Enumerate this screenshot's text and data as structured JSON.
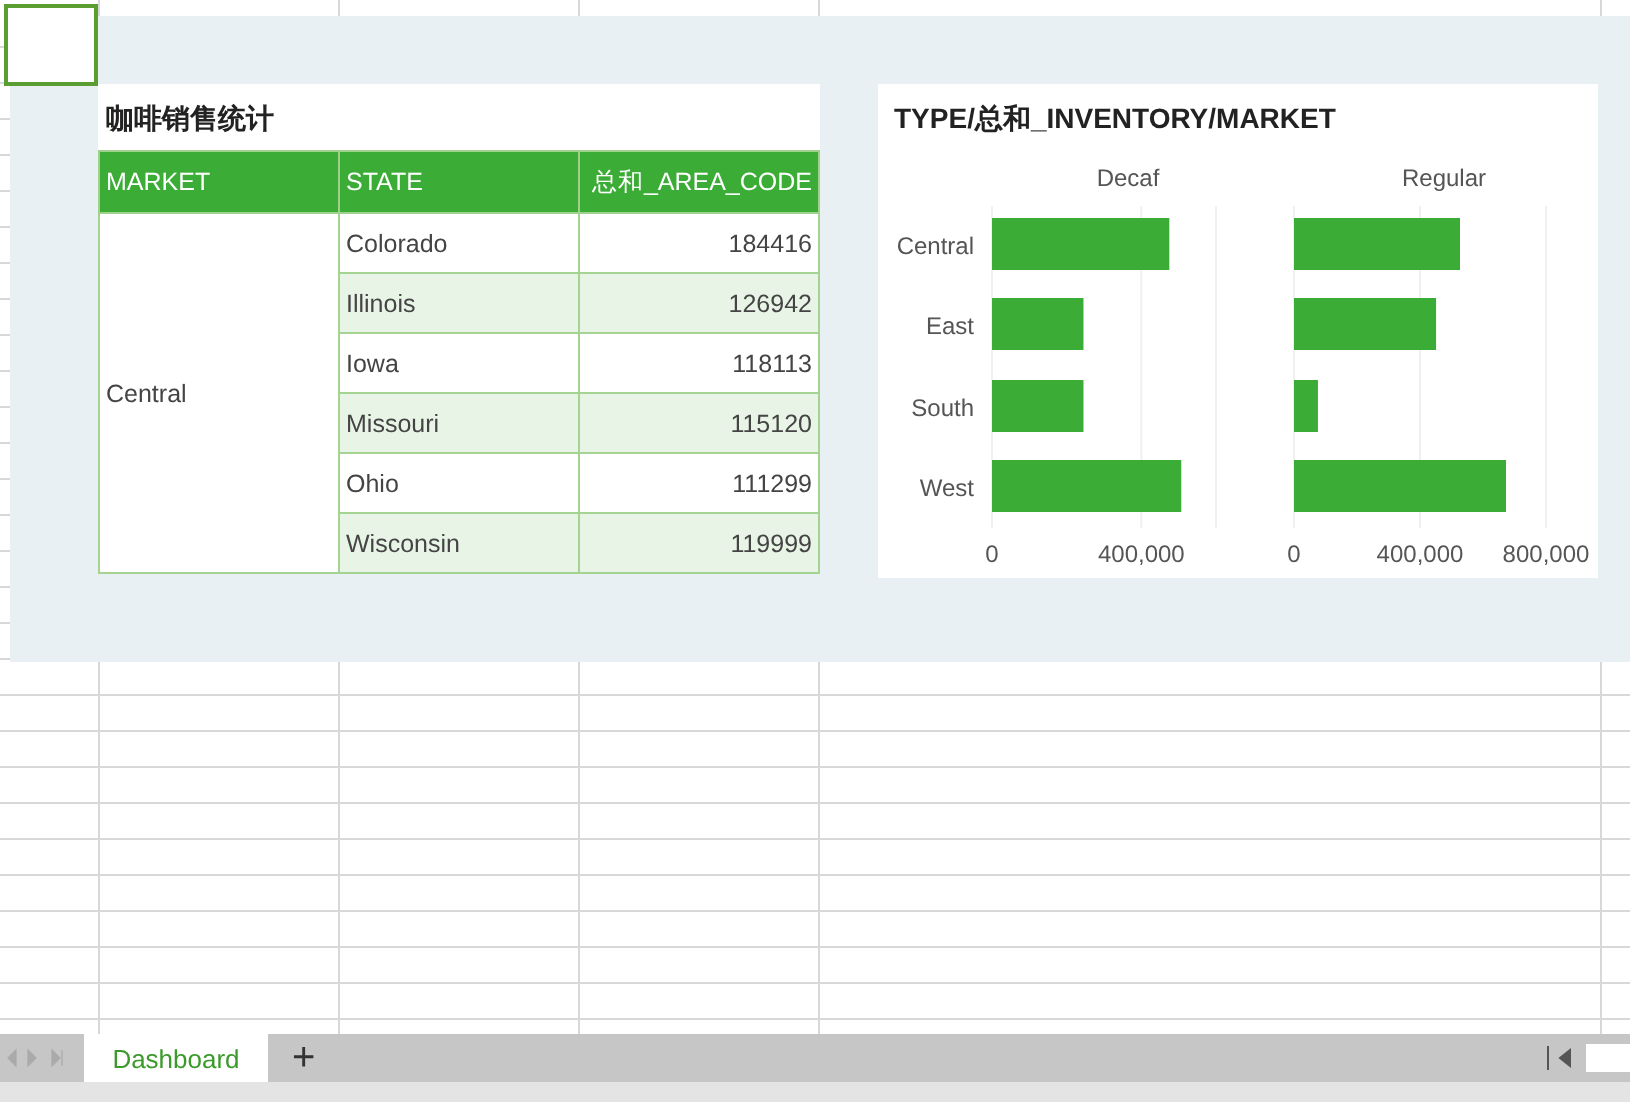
{
  "table": {
    "title": "咖啡销售统计",
    "columns": [
      "MARKET",
      "STATE",
      "总和_AREA_CODE"
    ],
    "groups": [
      {
        "market": "Central",
        "rows": [
          {
            "state": "Colorado",
            "value": "184416"
          },
          {
            "state": "Illinois",
            "value": "126942"
          },
          {
            "state": "Iowa",
            "value": "118113"
          },
          {
            "state": "Missouri",
            "value": "115120"
          },
          {
            "state": "Ohio",
            "value": "111299"
          },
          {
            "state": "Wisconsin",
            "value": "119999"
          }
        ]
      }
    ]
  },
  "chart": {
    "title": "TYPE/总和_INVENTORY/MARKET",
    "panels": [
      {
        "chart_data": {
          "type": "bar",
          "orientation": "horizontal",
          "categories": [
            "Central",
            "East",
            "South",
            "West"
          ],
          "series": [
            {
              "name": "Decaf",
              "color": "#3bad37",
              "values": [
                475000,
                245000,
                245000,
                507000
              ]
            }
          ],
          "xlim": [
            0,
            600000
          ],
          "xticks": [
            {
              "value": 0,
              "label": "0"
            },
            {
              "value": 400000,
              "label": "400,000"
            }
          ]
        }
      },
      {
        "chart_data": {
          "type": "bar",
          "orientation": "horizontal",
          "series": [
            {
              "name": "Regular",
              "color": "#3bad37",
              "values": [
                527000,
                451000,
                76000,
                673000
              ]
            }
          ],
          "xlim": [
            0,
            800000
          ],
          "xticks": [
            {
              "value": 0,
              "label": "0"
            },
            {
              "value": 400000,
              "label": "400,000"
            },
            {
              "value": 800000,
              "label": "800,000"
            }
          ]
        }
      }
    ]
  },
  "sheet_tabs": [
    {
      "label": "Dashboard",
      "selected": true
    }
  ],
  "add_sheet": "+"
}
